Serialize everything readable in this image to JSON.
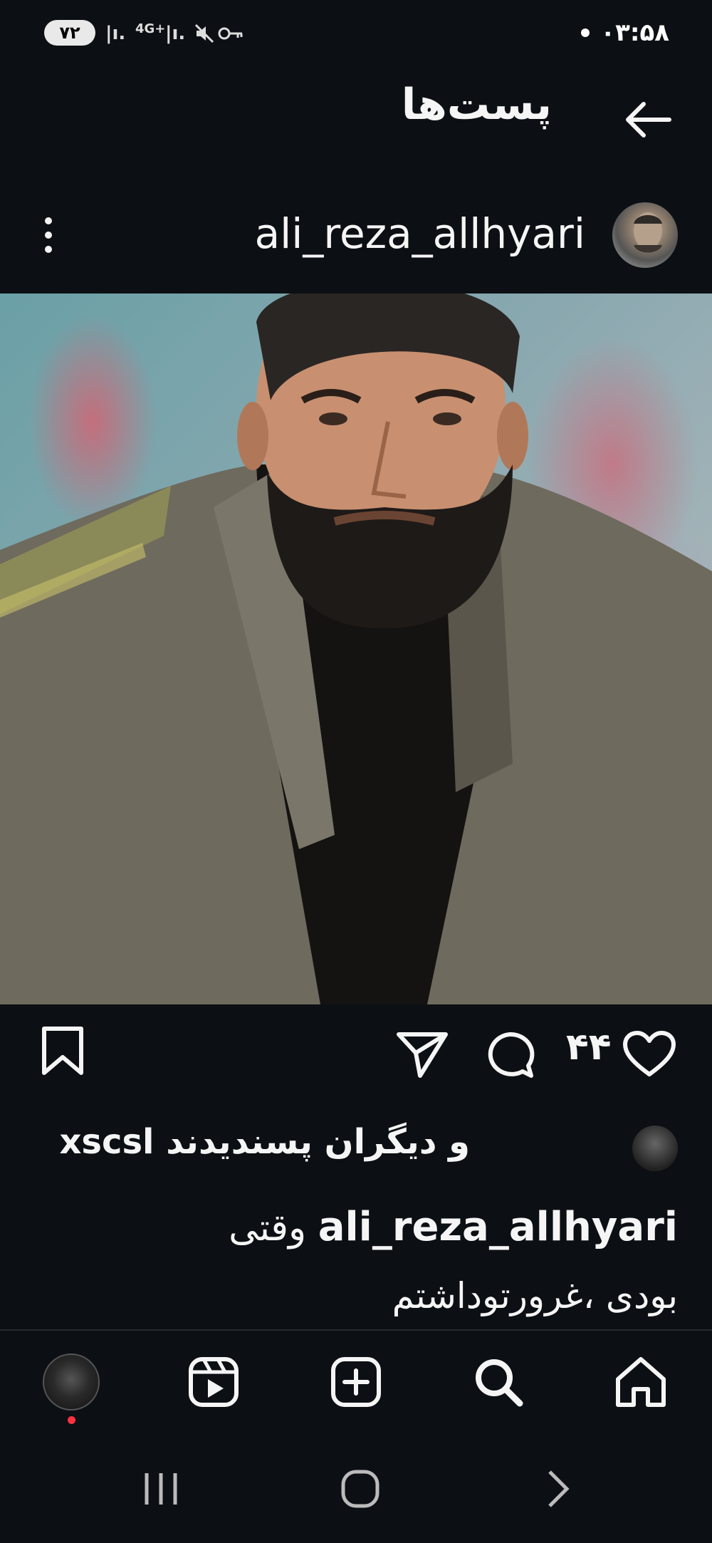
{
  "status_bar": {
    "battery": "۷۲",
    "network": "4G+",
    "time": "۰۳:۵۸"
  },
  "header": {
    "title": "پست‌ها"
  },
  "post": {
    "username": "ali_reza_allhyari",
    "likes_count": "۴۴",
    "liked_by_text": "و دیگران پسندیدند xscsl",
    "caption_username": "ali_reza_allhyari",
    "caption_line1": "وقتی",
    "caption_line2": "بودی ،غرورتوداشتم"
  },
  "icons": {
    "back": "back-arrow-icon",
    "more": "kebab-menu-icon",
    "like": "heart-icon",
    "comment": "comment-icon",
    "share": "send-icon",
    "save": "bookmark-icon",
    "home": "home-icon",
    "search": "search-icon",
    "create": "plus-square-icon",
    "reels": "reels-icon"
  },
  "colors": {
    "background": "#0c1014",
    "text": "#f5f5f5",
    "notification_dot": "#ff3040"
  }
}
